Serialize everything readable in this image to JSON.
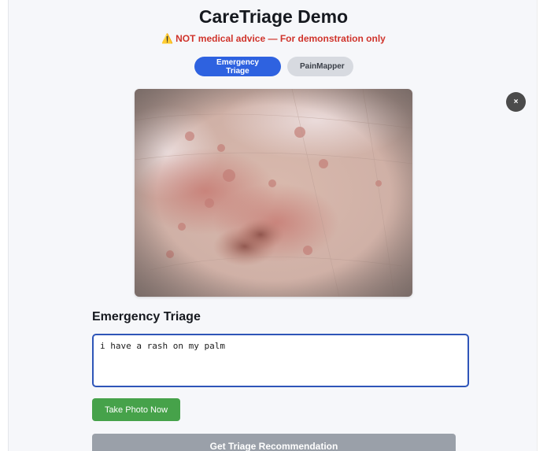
{
  "app": {
    "title": "CareTriage Demo",
    "warning_icon": "warning-icon",
    "warning_symbol": "⚠️",
    "warning": "NOT medical advice — For demonstration only"
  },
  "tabs": [
    {
      "label": "Emergency Triage",
      "active": true
    },
    {
      "label": "PainMapper",
      "active": false
    }
  ],
  "close": {
    "symbol": "×",
    "icon": "close-icon"
  },
  "photo": {
    "subject": "skin-rash-photo"
  },
  "section": {
    "heading": "Emergency Triage"
  },
  "symptoms": {
    "value": "i have a rash on my palm"
  },
  "buttons": {
    "take_photo": "Take Photo Now",
    "get_recommendation": "Get Triage Recommendation"
  },
  "colors": {
    "accent": "#2e62e0",
    "warning": "#d0342c",
    "photo_button": "#46a24a",
    "disabled_button": "#9aa0a9"
  }
}
